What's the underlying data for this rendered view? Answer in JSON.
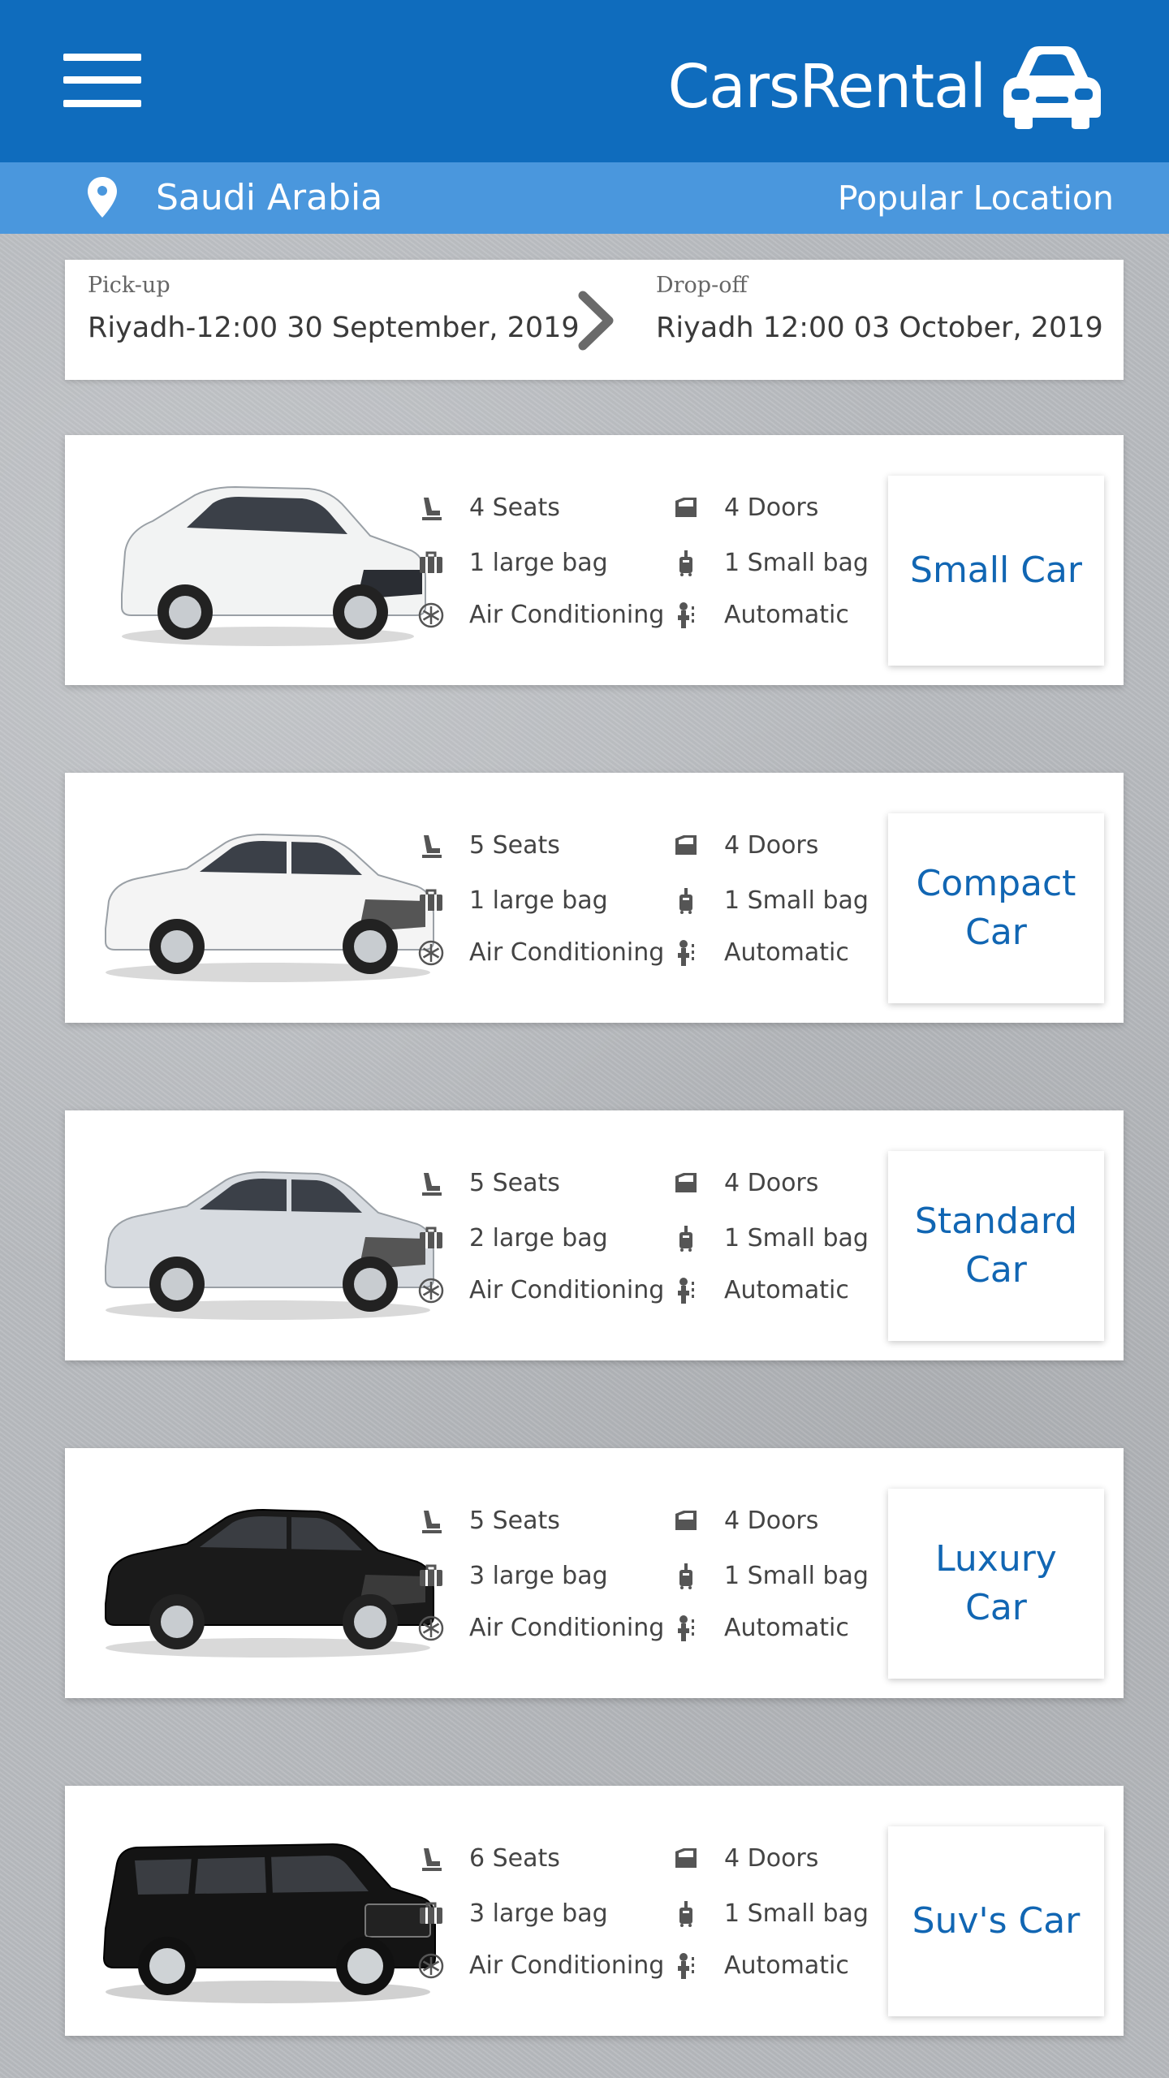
{
  "header": {
    "brand": "CarsRental",
    "menu_icon": "hamburger-menu-icon",
    "brand_icon": "car-icon"
  },
  "location_bar": {
    "country": "Saudi Arabia",
    "popular_link": "Popular Location"
  },
  "booking": {
    "pickup_label": "Pick-up",
    "pickup_value": "Riyadh-12:00 30 September, 2019",
    "dropoff_label": "Drop-off",
    "dropoff_value": "Riyadh 12:00 03 October, 2019"
  },
  "cars": [
    {
      "category": "Small Car",
      "seats": "4 Seats",
      "doors": "4 Doors",
      "large_bag": "1 large bag",
      "small_bag": "1 Small bag",
      "ac": "Air Conditioning",
      "transmission": "Automatic",
      "color": "#f2f3f3",
      "type": "hatch"
    },
    {
      "category": "Compact Car",
      "seats": "5 Seats",
      "doors": "4 Doors",
      "large_bag": "1 large bag",
      "small_bag": "1 Small bag",
      "ac": "Air Conditioning",
      "transmission": "Automatic",
      "color": "#f4f4f4",
      "type": "sedan"
    },
    {
      "category": "Standard Car",
      "seats": "5 Seats",
      "doors": "4 Doors",
      "large_bag": "2 large bag",
      "small_bag": "1 Small bag",
      "ac": "Air Conditioning",
      "transmission": "Automatic",
      "color": "#d7dbe0",
      "type": "sedan"
    },
    {
      "category": "Luxury Car",
      "seats": "5 Seats",
      "doors": "4 Doors",
      "large_bag": "3 large bag",
      "small_bag": "1 Small bag",
      "ac": "Air Conditioning",
      "transmission": "Automatic",
      "color": "#1a1a1a",
      "type": "sedan"
    },
    {
      "category": "Suv's Car",
      "seats": "6 Seats",
      "doors": "4 Doors",
      "large_bag": "3 large bag",
      "small_bag": "1 Small bag",
      "ac": "Air Conditioning",
      "transmission": "Automatic",
      "color": "#141414",
      "type": "suv"
    }
  ],
  "icons": {
    "seat": "seat-icon",
    "door": "door-icon",
    "large_bag": "luggage-icon",
    "small_bag": "small-bag-icon",
    "ac": "snowflake-icon",
    "transmission": "gear-shift-icon"
  }
}
